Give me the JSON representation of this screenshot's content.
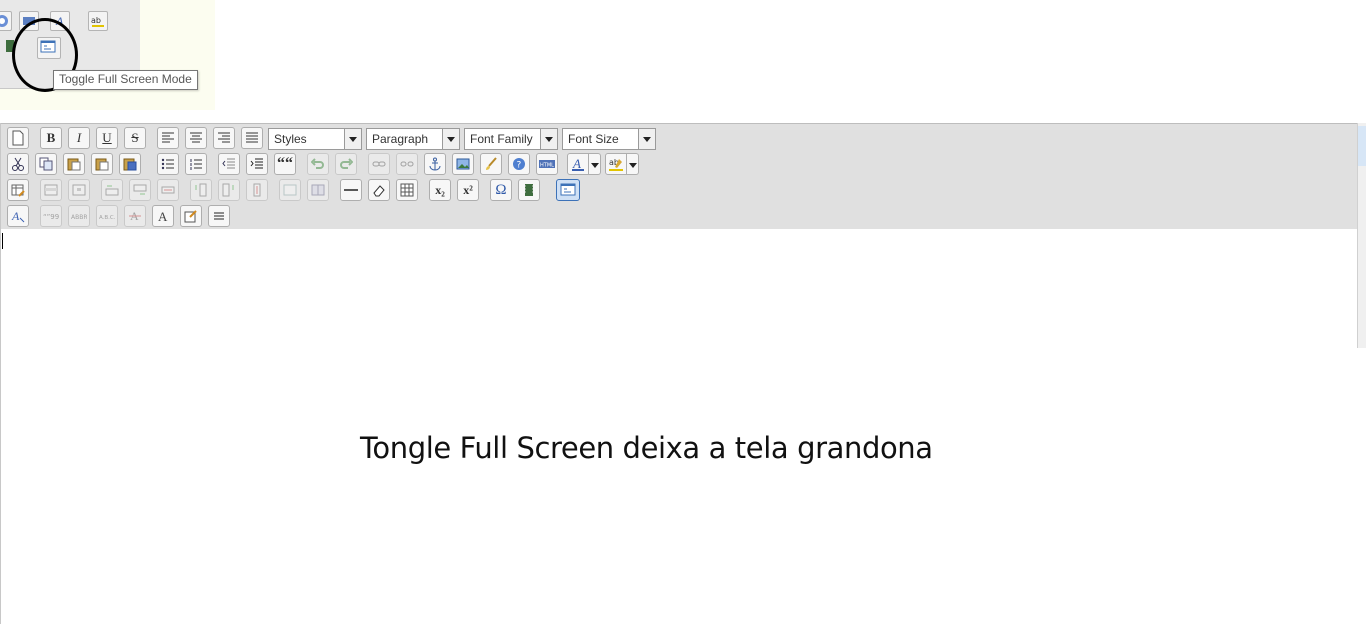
{
  "tooltip": {
    "text": "Toggle Full Screen Mode"
  },
  "toolbar": {
    "styles": "Styles",
    "format": "Paragraph",
    "font_family": "Font Family",
    "font_size": "Font Size",
    "bold": "B",
    "italic": "I",
    "underline": "U",
    "strike": "S",
    "quote": "““",
    "omega": "Ω",
    "sub": "x₂",
    "sup": "x²"
  },
  "content": {
    "caption": "Tongle Full Screen deixa a tela grandona"
  },
  "colors": {
    "toolbar_bg": "#e0e0e0",
    "active_button": "#3d72b8"
  }
}
